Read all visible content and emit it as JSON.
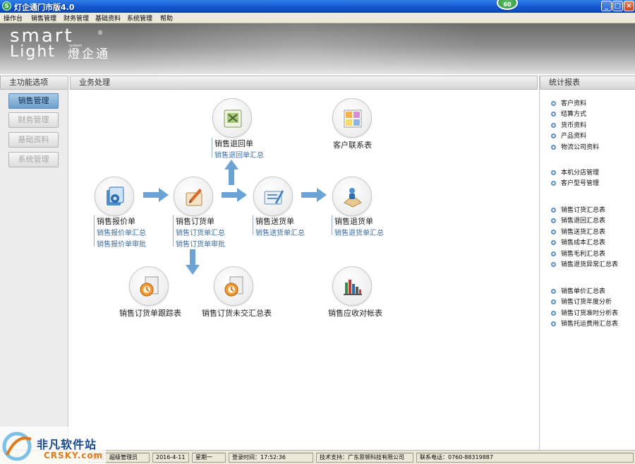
{
  "window": {
    "title": "灯企通门市版4.0",
    "badge": "60",
    "app_icon": "S"
  },
  "menu": [
    "操作台",
    "销售管理",
    "财务管理",
    "基础资料",
    "系统管理",
    "帮助"
  ],
  "banner": {
    "logo_word1": "smart",
    "logo_word2": "Light",
    "logo_registered": "®",
    "logo_system": "system",
    "logo_cn": "燈企通"
  },
  "left_panel": {
    "header": "主功能选项",
    "items": [
      "销售管理",
      "财务管理",
      "基础资料",
      "系统管理"
    ],
    "active_index": 0
  },
  "center_panel": {
    "header": "业务处理",
    "nodes": {
      "quote": {
        "title": "销售报价单",
        "links": [
          "销售报价单汇总",
          "销售报价单审批"
        ],
        "icon": "quote-icon"
      },
      "order": {
        "title": "销售订货单",
        "links": [
          "销售订货单汇总",
          "销售订货单审批"
        ],
        "icon": "order-icon"
      },
      "delivery": {
        "title": "销售送货单",
        "links": [
          "销售送货单汇总"
        ],
        "icon": "delivery-icon"
      },
      "refund": {
        "title": "销售退货单",
        "links": [
          "销售退货单汇总"
        ],
        "icon": "refund-icon"
      },
      "return_note": {
        "title": "销售退回单",
        "links": [
          "销售退回单汇总"
        ],
        "icon": "return-icon"
      },
      "contacts": {
        "title": "客户联系表",
        "links": [],
        "icon": "contacts-icon"
      },
      "tracking": {
        "title": "销售订货单跟踪表",
        "links": [],
        "icon": "tracking-icon"
      },
      "undelivered": {
        "title": "销售订货未交汇总表",
        "links": [],
        "icon": "undelivered-icon"
      },
      "receivable": {
        "title": "销售应收对帐表",
        "links": [],
        "icon": "receivable-icon"
      }
    }
  },
  "right_panel": {
    "header": "统计报表",
    "groups": [
      [
        "客户资料",
        "结算方式",
        "货币资料",
        "产品资料",
        "物流公司资料"
      ],
      [
        "本机分店管理",
        "客户型号管理"
      ],
      [
        "销售订货汇总表",
        "销售退回汇总表",
        "销售送货汇总表",
        "销售成本汇总表",
        "销售毛利汇总表",
        "销售退货异常汇总表"
      ],
      [
        "销售单价汇总表",
        "销售订货年度分析",
        "销售订货准时分析表",
        "销售托运费用汇总表"
      ]
    ]
  },
  "status_bar": {
    "user_label": "部门：",
    "user_value": "超级管理员",
    "date": "2016-4-11",
    "weekday": "星期一",
    "login_label": "登录时间：",
    "login_time": "17:52:36",
    "support": "技术支持：广东思顿科技有限公司",
    "phone": "联系电话：0760-88319887"
  },
  "watermark": {
    "text1": "非凡软件站",
    "text2": "CRSKY.com"
  }
}
